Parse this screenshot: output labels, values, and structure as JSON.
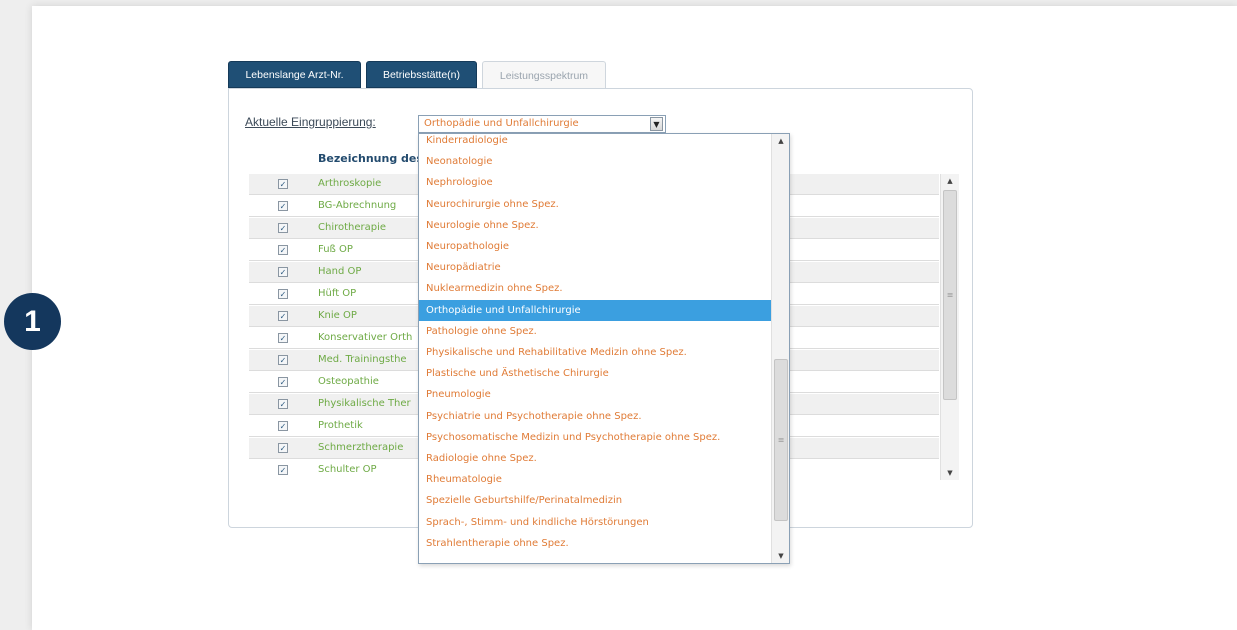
{
  "step_number": "1",
  "tabs": [
    {
      "label": "Lebenslange Arzt-Nr.",
      "active": true
    },
    {
      "label": "Betriebsstätte(n)",
      "active": true
    },
    {
      "label": "Leistungsspektrum",
      "active": false
    }
  ],
  "grouping": {
    "label": "Aktuelle Eingruppierung:",
    "selected_value": "Orthopädie und Unfallchirurgie"
  },
  "table": {
    "column_header": "Bezeichnung des",
    "rows": [
      {
        "name": "Arthroskopie",
        "checked": true
      },
      {
        "name": "BG-Abrechnung",
        "checked": true
      },
      {
        "name": "Chirotherapie",
        "checked": true
      },
      {
        "name": "Fuß OP",
        "checked": true
      },
      {
        "name": "Hand OP",
        "checked": true
      },
      {
        "name": "Hüft OP",
        "checked": true
      },
      {
        "name": "Knie OP",
        "checked": true
      },
      {
        "name": "Konservativer Orth",
        "checked": true
      },
      {
        "name": "Med. Trainingsthe",
        "checked": true
      },
      {
        "name": "Osteopathie",
        "checked": true
      },
      {
        "name": "Physikalische Ther",
        "checked": true
      },
      {
        "name": "Prothetik",
        "checked": true
      },
      {
        "name": "Schmerztherapie",
        "checked": true
      },
      {
        "name": "Schulter OP",
        "checked": true
      }
    ]
  },
  "dropdown_options": [
    "Kinderradiologie",
    "Neonatologie",
    "Nephrologioe",
    "Neurochirurgie ohne Spez.",
    "Neurologie ohne Spez.",
    "Neuropathologie",
    "Neuropädiatrie",
    "Nuklearmedizin ohne Spez.",
    "Orthopädie und Unfallchirurgie",
    "Pathologie ohne Spez.",
    "Physikalische und Rehabilitative Medizin ohne Spez.",
    "Plastische und Ästhetische Chirurgie",
    "Pneumologie",
    "Psychiatrie und Psychotherapie ohne Spez.",
    "Psychosomatische Medizin und Psychotherapie ohne Spez.",
    "Radiologie ohne Spez.",
    "Rheumatologie",
    "Spezielle Geburtshilfe/Perinatalmedizin",
    "Sprach-, Stimm- und kindliche Hörstörungen",
    "Strahlentherapie ohne Spez."
  ],
  "selected_option_index": 8,
  "colors": {
    "tab_active": "#1f4f75",
    "option_text": "#e07b36",
    "row_text": "#6eaa45",
    "selection": "#3b9fe0",
    "badge": "#14375d"
  }
}
